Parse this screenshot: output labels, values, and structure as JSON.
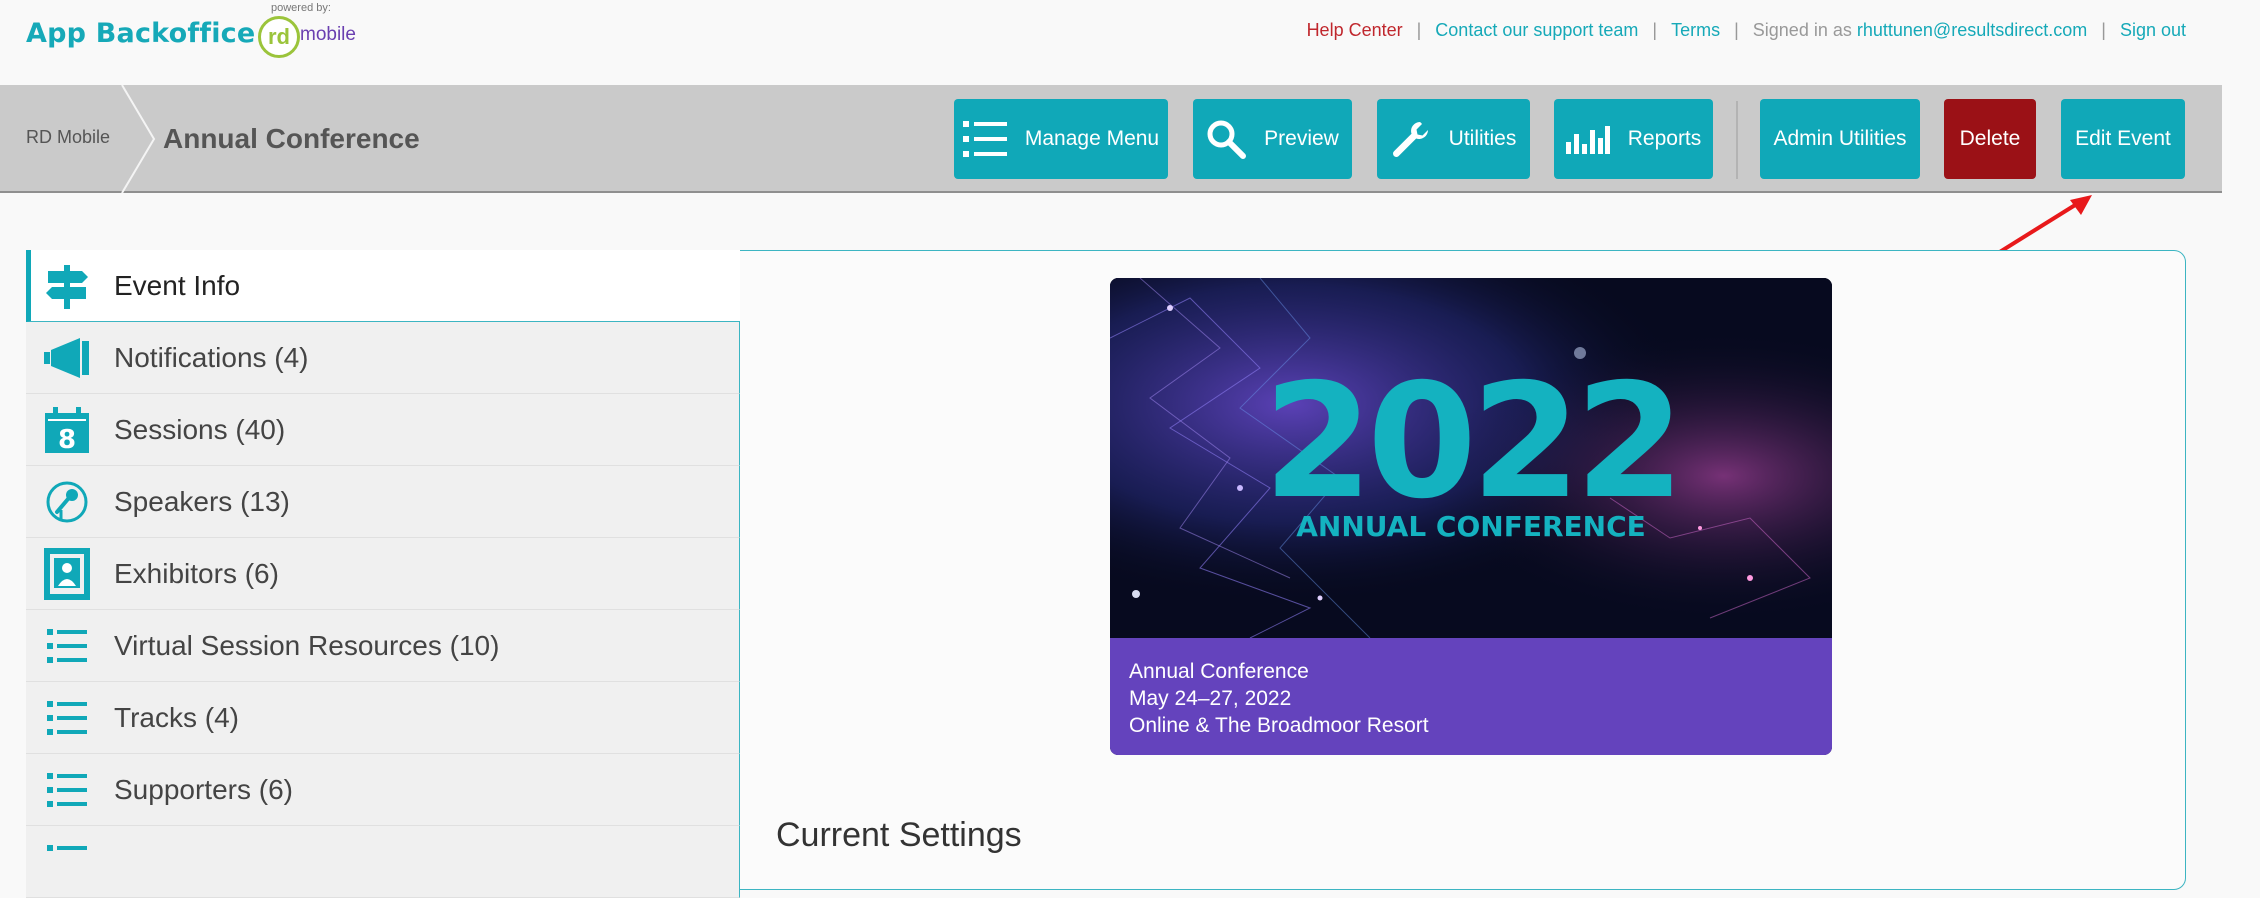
{
  "header": {
    "brand": "App Backoffice",
    "powered_by": "powered by:",
    "logo_rd": "rd",
    "logo_mobile": "mobile",
    "links": {
      "help": "Help Center",
      "contact": "Contact our support team",
      "terms": "Terms",
      "signed_in_prefix": "Signed in as",
      "user_email": "rhuttunen@resultsdirect.com",
      "sign_out": "Sign out"
    }
  },
  "breadcrumb": {
    "root": "RD Mobile",
    "current": "Annual Conference"
  },
  "toolbar": {
    "manage_menu": "Manage Menu",
    "preview": "Preview",
    "utilities": "Utilities",
    "reports": "Reports",
    "admin_utilities": "Admin Utilities",
    "delete": "Delete",
    "edit_event": "Edit Event"
  },
  "sidebar": {
    "items": [
      {
        "label": "Event Info",
        "icon": "signpost-icon"
      },
      {
        "label": "Notifications (4)",
        "icon": "megaphone-icon"
      },
      {
        "label": "Sessions (40)",
        "icon": "calendar-icon"
      },
      {
        "label": "Speakers (13)",
        "icon": "microphone-icon"
      },
      {
        "label": "Exhibitors (6)",
        "icon": "booth-icon"
      },
      {
        "label": "Virtual Session Resources (10)",
        "icon": "list-icon"
      },
      {
        "label": "Tracks (4)",
        "icon": "list-icon"
      },
      {
        "label": "Supporters (6)",
        "icon": "list-icon"
      }
    ]
  },
  "event_card": {
    "year": "2022",
    "subtitle": "ANNUAL CONFERENCE",
    "name": "Annual Conference",
    "dates": "May 24–27, 2022",
    "location": "Online & The Broadmoor Resort"
  },
  "main": {
    "section_title": "Current Settings"
  },
  "colors": {
    "accent": "#10a8b8",
    "danger": "#9b1116",
    "card_footer": "#6443bd",
    "annotation_arrow": "#e8191b"
  }
}
